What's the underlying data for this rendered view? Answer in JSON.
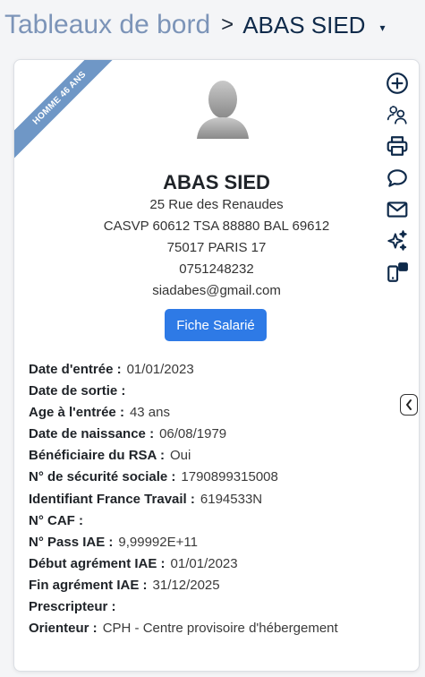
{
  "breadcrumb": {
    "parent": "Tableaux de bord",
    "separator": ">",
    "current": "ABAS SIED",
    "caret": "▾"
  },
  "profile": {
    "ribbon": "HOMME 46 ANS",
    "name": "ABAS SIED",
    "address_line1": "25 Rue des Renaudes",
    "address_line2": "CASVP 60612 TSA 88880 BAL 69612",
    "address_line3": "75017 PARIS 17",
    "phone": "0751248232",
    "email": "siadabes@gmail.com",
    "fiche_button": "Fiche Salarié"
  },
  "details": [
    {
      "label": "Date d'entrée :",
      "value": "01/01/2023"
    },
    {
      "label": "Date de sortie :",
      "value": ""
    },
    {
      "label": "Age à l'entrée :",
      "value": "43 ans"
    },
    {
      "label": "Date de naissance :",
      "value": "06/08/1979"
    },
    {
      "label": "Bénéficiaire du RSA :",
      "value": "Oui"
    },
    {
      "label": "N° de sécurité sociale :",
      "value": "1790899315008"
    },
    {
      "label": "Identifiant France Travail :",
      "value": "6194533N"
    },
    {
      "label": "N° CAF :",
      "value": ""
    },
    {
      "label": "N° Pass IAE :",
      "value": "9,99992E+11"
    },
    {
      "label": "Début agrément IAE :",
      "value": "01/01/2023"
    },
    {
      "label": "Fin agrément IAE :",
      "value": "31/12/2025"
    },
    {
      "label": "Prescripteur :",
      "value": ""
    },
    {
      "label": "Orienteur :",
      "value": "CPH - Centre provisoire d'hébergement"
    }
  ],
  "actions": [
    "add-circle-icon",
    "users-icon",
    "printer-icon",
    "chat-icon",
    "mail-icon",
    "sparkles-icon",
    "devices-icon"
  ],
  "colors": {
    "accent": "#2e7ae6",
    "ribbon": "#6f97c6",
    "icons": "#0f2a4a",
    "breadcrumb_link": "#7c94b8"
  }
}
